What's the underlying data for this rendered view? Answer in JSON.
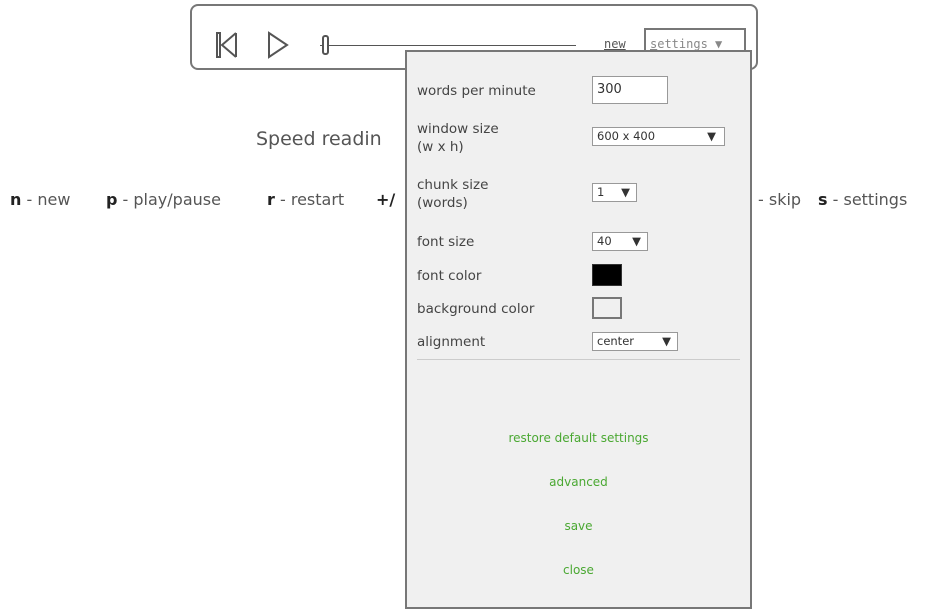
{
  "player": {
    "new_label": "new",
    "settings_tab": {
      "prefix": "s",
      "rest": "ettings",
      "arrow": "▼"
    },
    "progress_fraction": 0.0
  },
  "page": {
    "title": "Speed readin",
    "shortcuts": [
      {
        "key": "n",
        "desc": " - new"
      },
      {
        "key": "p",
        "desc": " - play/pause"
      },
      {
        "key": "r",
        "desc": " - restart"
      },
      {
        "key": "+/",
        "desc": ""
      },
      {
        "key": "",
        "desc": "- skip"
      },
      {
        "key": "s",
        "desc": " - settings"
      }
    ]
  },
  "settings": {
    "words_per_minute": {
      "label": "words per minute",
      "value": "300"
    },
    "window_size": {
      "label_line1": "window size",
      "label_line2": "(w x h)",
      "value": "600 x 400",
      "arrow": "▼"
    },
    "chunk_size": {
      "label_line1": "chunk size",
      "label_line2": "(words)",
      "value": "1",
      "arrow": "▼"
    },
    "font_size": {
      "label": "font size",
      "value": "40",
      "arrow": "▼"
    },
    "font_color": {
      "label": "font color",
      "color": "#000000"
    },
    "background_color": {
      "label": "background color",
      "color": "#f0f0f0"
    },
    "alignment": {
      "label": "alignment",
      "value": "center",
      "arrow": "▼"
    },
    "actions": {
      "restore": "restore default settings",
      "advanced": "advanced",
      "save": "save",
      "close": "close"
    }
  },
  "colors": {
    "accent_green": "#4aa832",
    "border_gray": "#777777"
  }
}
